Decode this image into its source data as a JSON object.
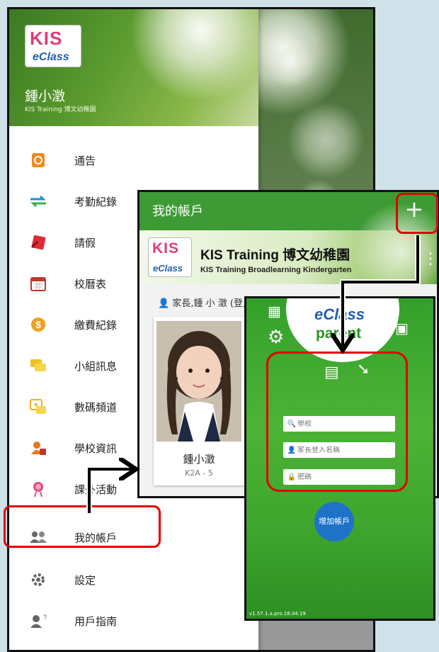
{
  "colors": {
    "brand_green": "#3d9a34",
    "highlight_red": "#e00000",
    "add_button_blue": "#1e73c9"
  },
  "drawer": {
    "logo": {
      "top": "KIS",
      "bottom": "eClass"
    },
    "user_name": "鍾小澂",
    "school": "KIS Training 博文幼稚園",
    "items": [
      {
        "label": "通告",
        "icon": "notice-icon"
      },
      {
        "label": "考勤紀錄",
        "icon": "attendance-arrows-icon"
      },
      {
        "label": "請假",
        "icon": "leave-icon"
      },
      {
        "label": "校曆表",
        "icon": "calendar-icon"
      },
      {
        "label": "繳費紀錄",
        "icon": "dollar-icon"
      },
      {
        "label": "小組訊息",
        "icon": "group-message-icon"
      },
      {
        "label": "數碼頻道",
        "icon": "digital-channel-icon"
      },
      {
        "label": "學校資訊",
        "icon": "school-info-icon"
      },
      {
        "label": "課外活動",
        "icon": "activities-icon"
      },
      {
        "label": "我的帳戶",
        "icon": "my-account-icon"
      },
      {
        "label": "設定",
        "icon": "gear-icon"
      },
      {
        "label": "用戶指南",
        "icon": "user-guide-icon"
      }
    ]
  },
  "account_screen": {
    "title": "我的帳戶",
    "add_symbol": "+",
    "school_name": "KIS Training 博文幼稚園",
    "school_name_en": "KIS Training Broadlearning Kindergarten",
    "parent_label": "家長,鍾 小 澂 (登入)",
    "child_name": "鍾小澂",
    "child_class": "K2A - 5"
  },
  "login_screen": {
    "logo_top": "eClass",
    "logo_bottom": "parent",
    "school_placeholder": "學校",
    "login_placeholder": "家長登入名稱",
    "password_placeholder": "密碼",
    "add_account_button": "增加帳戶",
    "version": "v1.57.1.a.pro.18.04.19"
  }
}
